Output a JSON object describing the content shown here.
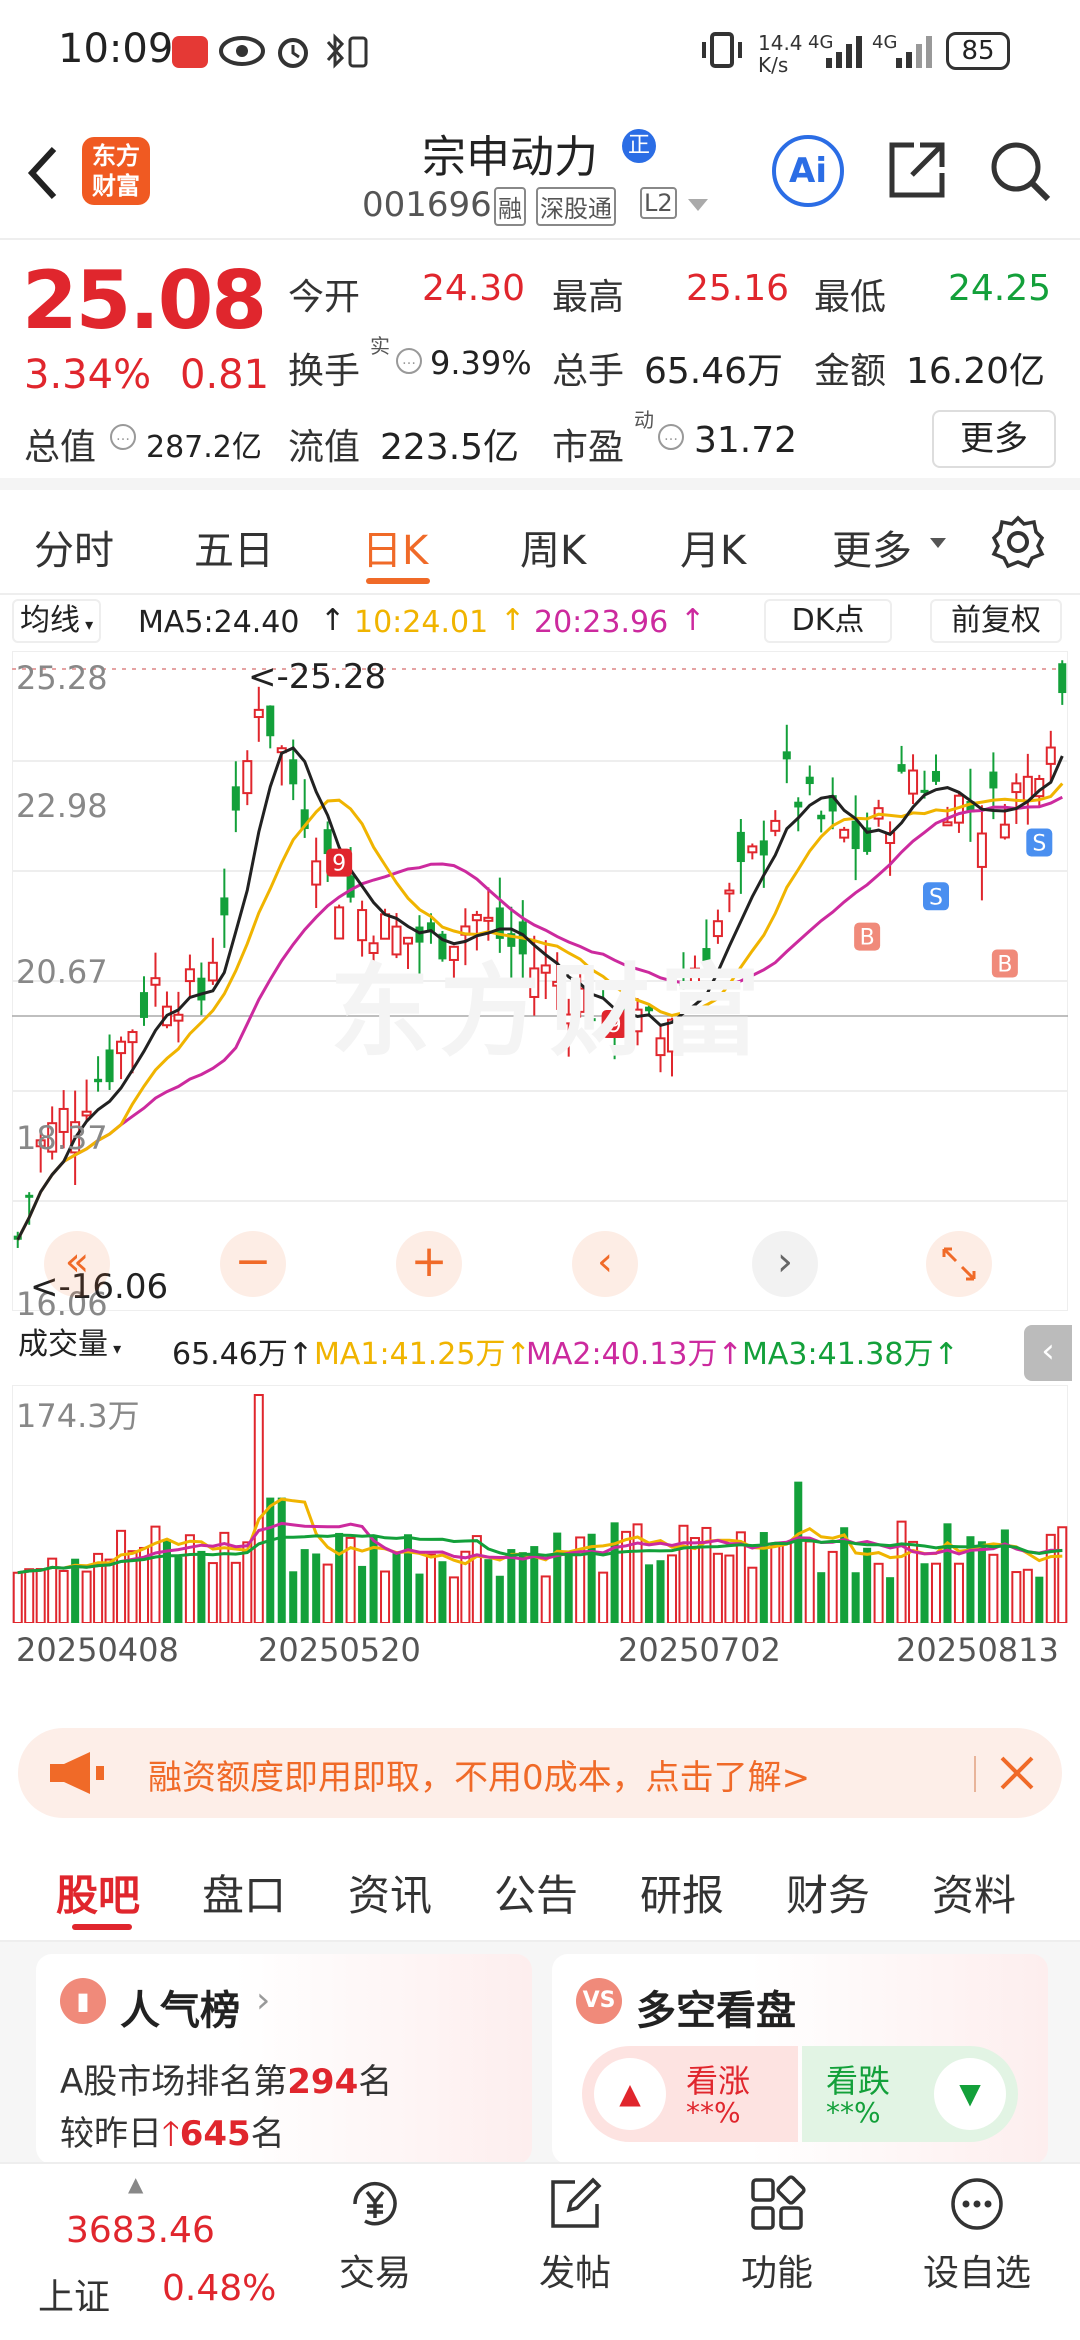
{
  "status": {
    "time": "10:09",
    "net_speed": "14.4\nK/s",
    "battery": "85",
    "signal1": "4G",
    "signal2": "4G"
  },
  "header": {
    "title": "宗申动力",
    "code": "001696",
    "badge_rong": "融",
    "badge_sgt": "深股通",
    "badge_l2": "L2",
    "logo_line1": "东方",
    "logo_line2": "财富",
    "ai_label": "Ai"
  },
  "quote": {
    "price": "25.08",
    "change_pct": "3.34%",
    "change": "0.81",
    "items": [
      {
        "label": "今开",
        "value": "24.30",
        "color": "red"
      },
      {
        "label": "最高",
        "value": "25.16",
        "color": "red"
      },
      {
        "label": "最低",
        "value": "24.25",
        "color": "green"
      },
      {
        "label": "换手",
        "value": "9.39%",
        "color": "dark"
      },
      {
        "label": "总手",
        "value": "65.46万",
        "color": "dark"
      },
      {
        "label": "金额",
        "value": "16.20亿",
        "color": "dark"
      },
      {
        "label": "总值",
        "value": "287.2亿",
        "color": "dark"
      },
      {
        "label": "流值",
        "value": "223.5亿",
        "color": "dark"
      },
      {
        "label": "市盈",
        "value": "31.72",
        "color": "dark"
      }
    ],
    "sup_shi": "实",
    "sup_dong": "动",
    "more": "更多"
  },
  "tabs": [
    "分时",
    "五日",
    "日K",
    "周K",
    "月K",
    "更多"
  ],
  "active_tab": "日K",
  "ma_bar": {
    "selector": "均线",
    "ma5": "MA5:24.40",
    "ma10": "10:24.01",
    "ma20": "20:23.96",
    "dk": "DK点",
    "fq": "前复权"
  },
  "price_axis": [
    "25.28",
    "22.98",
    "20.67",
    "18.37",
    "16.06"
  ],
  "price_marks": {
    "high": "<-25.28",
    "low": "<-16.06"
  },
  "vol_bar": {
    "selector": "成交量",
    "vol": "65.46万",
    "ma1": "MA1:41.25万",
    "ma2": "MA2:40.13万",
    "ma3": "MA3:41.38万",
    "axis_max": "174.3万"
  },
  "dates": [
    "20250408",
    "20250520",
    "20250702",
    "20250813"
  ],
  "watermark": "东方财富",
  "banner": {
    "text": "融资额度即用即取，不用0成本，点击了解>"
  },
  "tabs2": [
    "股吧",
    "盘口",
    "资讯",
    "公告",
    "研报",
    "财务",
    "资料"
  ],
  "active_tab2": "股吧",
  "card1": {
    "title": "人气榜",
    "line1_pre": "A股市场排名第",
    "rank": "294",
    "line1_post": "名",
    "line2_pre": "较昨日",
    "delta": "645",
    "line2_post": "名"
  },
  "card2": {
    "title": "多空看盘",
    "up": "看涨",
    "up_pct": "**%",
    "down": "看跌",
    "down_pct": "**%"
  },
  "bottom": {
    "index_val": "3683.46",
    "index_name": "上证",
    "index_pct": "0.48%",
    "nav": [
      "交易",
      "发帖",
      "功能",
      "设自选"
    ]
  },
  "colors": {
    "up": "#e0262d",
    "down": "#13a03a",
    "accent": "#f06a28",
    "ma5": "#222222",
    "ma10": "#f0b400",
    "ma20": "#cc2a9e",
    "brand": "#f05a22"
  }
}
